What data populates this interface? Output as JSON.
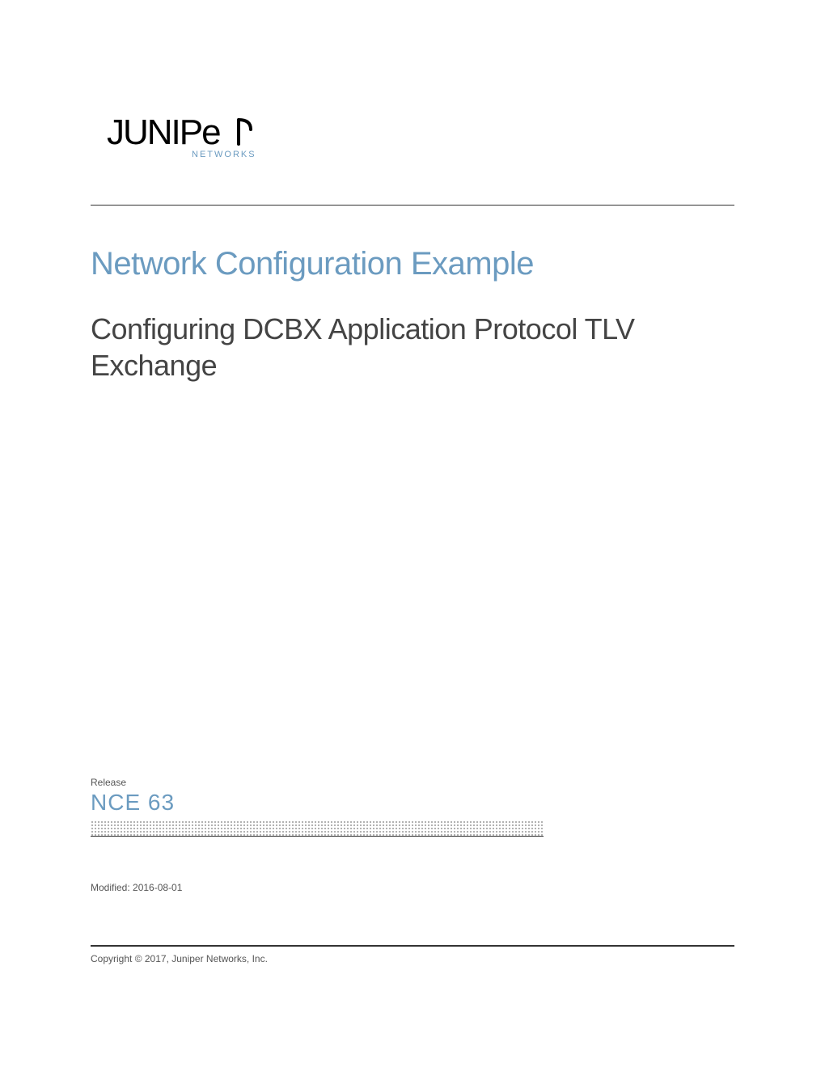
{
  "logo": {
    "networks_label": "NETWORKS"
  },
  "category_title": "Network Configuration Example",
  "doc_title": "Configuring DCBX Application Protocol TLV Exchange",
  "release": {
    "label": "Release",
    "version": "NCE 63"
  },
  "modified": "Modified: 2016-08-01",
  "copyright": "Copyright © 2017, Juniper Networks, Inc."
}
